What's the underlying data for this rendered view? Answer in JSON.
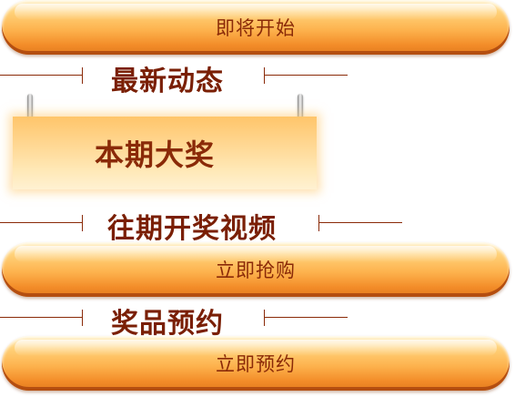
{
  "buttons": {
    "coming_soon": "即将开始",
    "buy_now": "立即抢购",
    "reserve_now": "立即预约"
  },
  "headers": {
    "latest_news": "最新动态",
    "past_videos": "往期开奖视频",
    "prize_reservation": "奖品预约"
  },
  "sign": {
    "current_prize": "本期大奖"
  },
  "colors": {
    "button_orange": "#fdb24d",
    "text_dark_red": "#8a2a08"
  }
}
